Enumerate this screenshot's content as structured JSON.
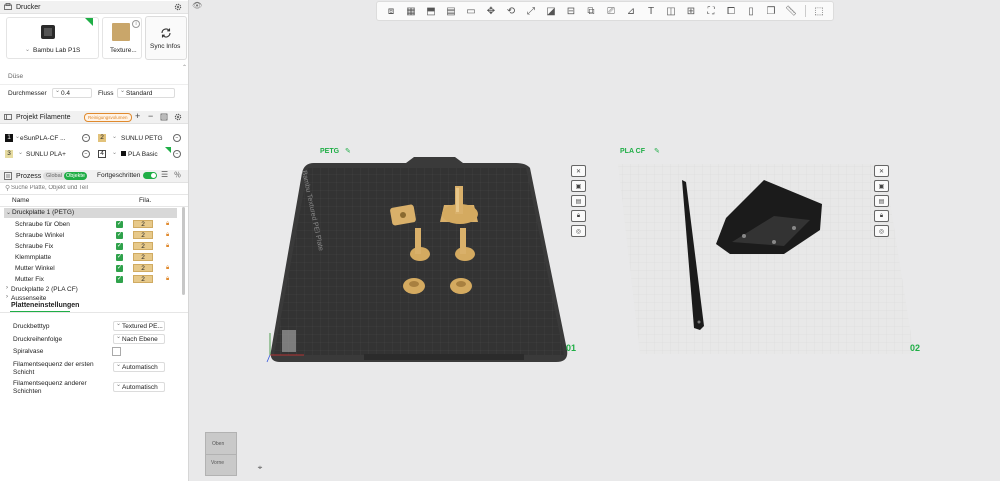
{
  "printer": {
    "section_title": "Drucker",
    "printer_name": "Bambu Lab P1S",
    "plate_name": "Texture...",
    "sync_label": "Sync Infos",
    "nozzle_title": "Düse",
    "diameter_label": "Durchmesser",
    "diameter_value": "0.4",
    "flow_label": "Fluss",
    "flow_value": "Standard"
  },
  "filaments": {
    "section_title": "Projekt Filamente",
    "cleanup_badge": "Reinigungsvolumen",
    "items": [
      {
        "num": "1",
        "name": "eSunPLA-CF ...",
        "color": "#111111",
        "text_color": "#ffffff"
      },
      {
        "num": "2",
        "name": "SUNLU PETG",
        "color": "#e2c27a",
        "text_color": "#222222"
      },
      {
        "num": "3",
        "name": "SUNLU PLA+",
        "color": "#e6dba0",
        "text_color": "#222222"
      },
      {
        "num": "4",
        "name": "PLA Basic",
        "color": "#ffffff",
        "text_color": "#222222"
      }
    ]
  },
  "process": {
    "section_title": "Prozess",
    "tab_global": "Global",
    "tab_objects": "Objekte",
    "advanced_label": "Fortgeschritten",
    "search_placeholder": "Suche Platte, Objekt und Teil",
    "col_name": "Name",
    "col_fila": "Fila.",
    "plate1": "Druckplatte 1 (PETG)",
    "objects": [
      {
        "name": "Schraube für Oben",
        "fila": "2",
        "locked": true
      },
      {
        "name": "Schraube Winkel",
        "fila": "2",
        "locked": true
      },
      {
        "name": "Schraube Fix",
        "fila": "2",
        "locked": true
      },
      {
        "name": "Klemmplatte",
        "fila": "2",
        "locked": false
      },
      {
        "name": "Mutter Winkel",
        "fila": "2",
        "locked": true
      },
      {
        "name": "Mutter Fix",
        "fila": "2",
        "locked": true
      }
    ],
    "plate2": "Druckplatte 2 (PLA CF)",
    "outside": "Aussenseite"
  },
  "plate_settings": {
    "title": "Platteneinstellungen",
    "bed_type_label": "Druckbetttyp",
    "bed_type_value": "Textured PE...",
    "sequence_label": "Druckreihenfolge",
    "sequence_value": "Nach Ebene",
    "spiral_label": "Spiralvase",
    "first_layer_label": "Filamentsequenz der ersten Schicht",
    "first_layer_value": "Automatisch",
    "other_layers_label": "Filamentsequenz anderer Schichten",
    "other_layers_value": "Automatisch"
  },
  "viewport": {
    "plate1_label": "PETG",
    "plate1_number": "01",
    "plate1_bed_text": "Bambu Textured PEI Plate",
    "plate2_label": "PLA CF",
    "plate2_number": "02",
    "cube_top": "Oben",
    "cube_front": "Vorne",
    "accent": "#1fae46"
  }
}
